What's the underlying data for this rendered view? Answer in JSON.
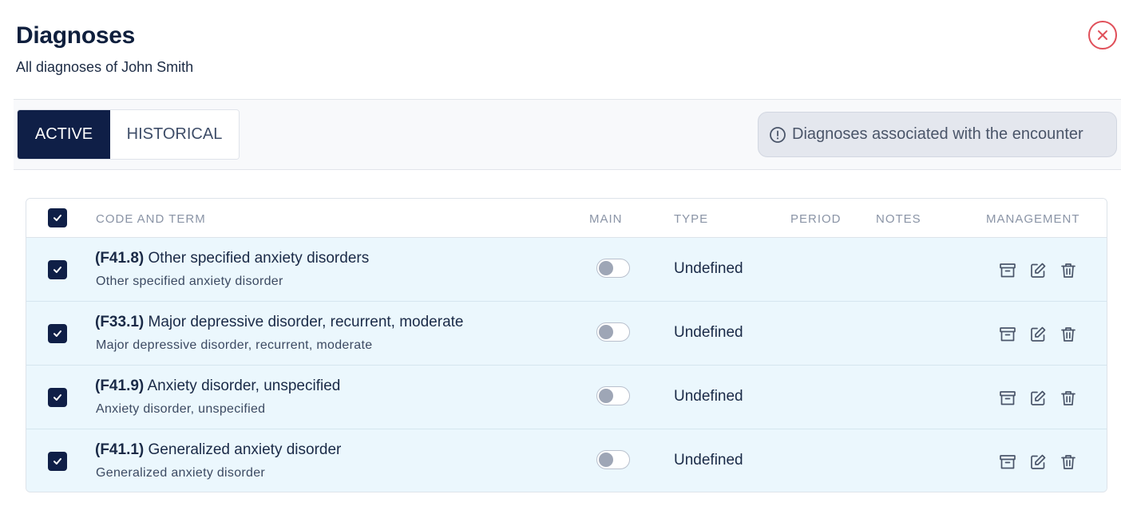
{
  "header": {
    "title": "Diagnoses",
    "subtitle": "All diagnoses of John Smith"
  },
  "tabs": [
    {
      "label": "ACTIVE",
      "active": true
    },
    {
      "label": "HISTORICAL",
      "active": false
    }
  ],
  "info": {
    "text": "Diagnoses associated with the encounter"
  },
  "table": {
    "columns": [
      "CODE AND TERM",
      "MAIN",
      "TYPE",
      "PERIOD",
      "NOTES",
      "MANAGEMENT"
    ],
    "rows": [
      {
        "code": "(F41.8)",
        "term": "Other specified anxiety disorders",
        "description": "Other specified anxiety disorder",
        "type": "Undefined",
        "main": false,
        "checked": true
      },
      {
        "code": "(F33.1)",
        "term": "Major depressive disorder, recurrent, moderate",
        "description": "Major depressive disorder, recurrent, moderate",
        "type": "Undefined",
        "main": false,
        "checked": true
      },
      {
        "code": "(F41.9)",
        "term": "Anxiety disorder, unspecified",
        "description": "Anxiety disorder, unspecified",
        "type": "Undefined",
        "main": false,
        "checked": true
      },
      {
        "code": "(F41.1)",
        "term": "Generalized anxiety disorder",
        "description": "Generalized anxiety disorder",
        "type": "Undefined",
        "main": false,
        "checked": true
      }
    ]
  },
  "icons": {
    "close": "close-icon",
    "info": "info-icon",
    "check": "check-icon",
    "archive": "archive-icon",
    "edit": "edit-icon",
    "delete": "trash-icon"
  },
  "colors": {
    "primary": "#0f1f47",
    "close": "#e0505a",
    "row_background": "#ebf7fd",
    "info_background": "#e4e7ee"
  }
}
